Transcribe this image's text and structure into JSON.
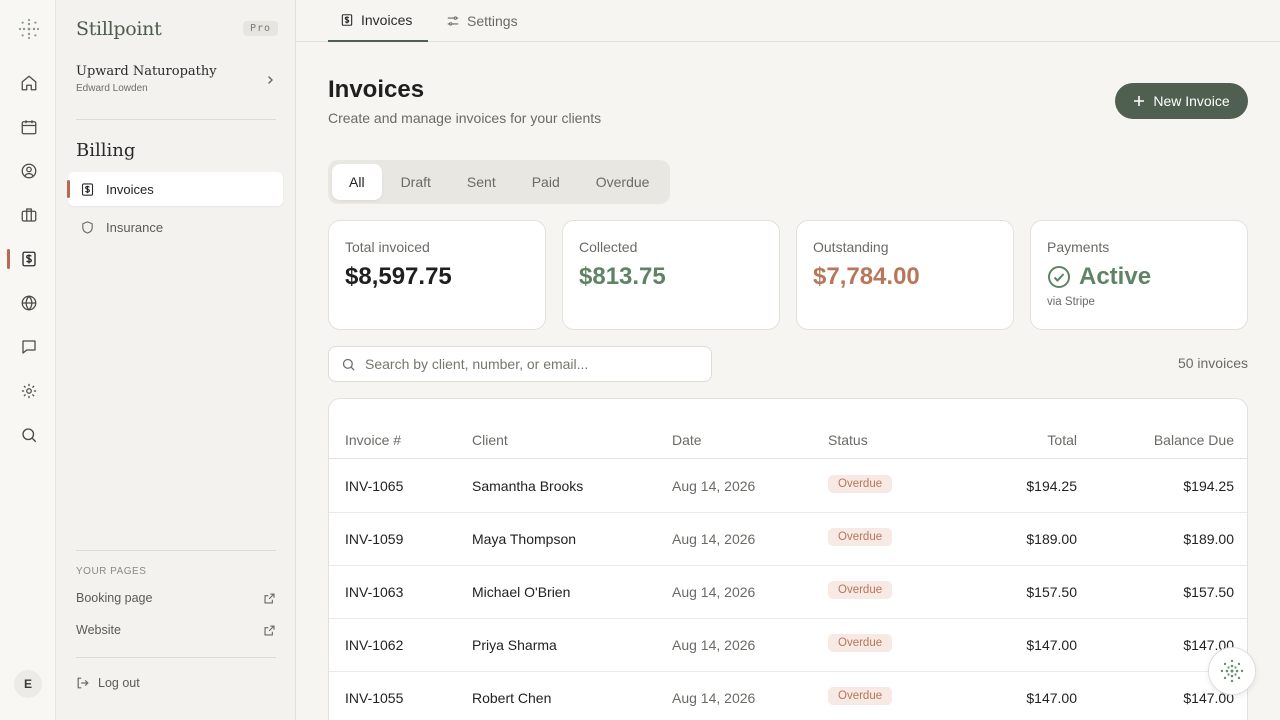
{
  "app": {
    "brand": "Stillpoint",
    "plan_badge": "Pro"
  },
  "practice": {
    "name": "Upward Naturopathy",
    "owner": "Edward Lowden"
  },
  "rail": {
    "items": [
      "home-icon",
      "calendar-icon",
      "user-circle-icon",
      "briefcase-icon",
      "invoice-icon",
      "globe-icon",
      "chat-icon",
      "gear-icon",
      "search-icon"
    ],
    "active": "invoice-icon",
    "avatar_initial": "E"
  },
  "sidebar": {
    "section_title": "Billing",
    "items": [
      {
        "label": "Invoices",
        "icon": "invoice-icon",
        "active": true
      },
      {
        "label": "Insurance",
        "icon": "shield-icon",
        "active": false
      }
    ],
    "pages_heading": "YOUR PAGES",
    "pages": [
      {
        "label": "Booking page",
        "icon": "external-link-icon"
      },
      {
        "label": "Website",
        "icon": "external-link-icon"
      }
    ],
    "logout_label": "Log out"
  },
  "tabs": [
    {
      "label": "Invoices",
      "icon": "invoice-icon",
      "active": true
    },
    {
      "label": "Settings",
      "icon": "sliders-icon",
      "active": false
    }
  ],
  "header": {
    "title": "Invoices",
    "subtitle": "Create and manage invoices for your clients",
    "new_button": "New Invoice"
  },
  "filters": {
    "options": [
      "All",
      "Draft",
      "Sent",
      "Paid",
      "Overdue"
    ],
    "selected": "All"
  },
  "stats": {
    "total": {
      "label": "Total invoiced",
      "value": "$8,597.75"
    },
    "collected": {
      "label": "Collected",
      "value": "$813.75"
    },
    "outstanding": {
      "label": "Outstanding",
      "value": "$7,784.00"
    },
    "payments": {
      "label": "Payments",
      "value": "Active",
      "note": "via Stripe"
    }
  },
  "search": {
    "placeholder": "Search by client, number, or email...",
    "value": ""
  },
  "count": "50 invoices",
  "table": {
    "columns": [
      "Invoice #",
      "Client",
      "Date",
      "Status",
      "Total",
      "Balance Due"
    ],
    "rows": [
      {
        "number": "INV-1065",
        "client": "Samantha Brooks",
        "date": "Aug 14, 2026",
        "status": "Overdue",
        "total": "$194.25",
        "balance": "$194.25"
      },
      {
        "number": "INV-1059",
        "client": "Maya Thompson",
        "date": "Aug 14, 2026",
        "status": "Overdue",
        "total": "$189.00",
        "balance": "$189.00"
      },
      {
        "number": "INV-1063",
        "client": "Michael O'Brien",
        "date": "Aug 14, 2026",
        "status": "Overdue",
        "total": "$157.50",
        "balance": "$157.50"
      },
      {
        "number": "INV-1062",
        "client": "Priya Sharma",
        "date": "Aug 14, 2026",
        "status": "Overdue",
        "total": "$147.00",
        "balance": "$147.00"
      },
      {
        "number": "INV-1055",
        "client": "Robert Chen",
        "date": "Aug 14, 2026",
        "status": "Overdue",
        "total": "$147.00",
        "balance": "$147.00"
      }
    ]
  },
  "colors": {
    "accent": "#4f6050",
    "collected": "#5e8465",
    "outstanding": "#b8765a",
    "overdue_bg": "#f7e9e3",
    "active_marker": "#b86a4e"
  }
}
